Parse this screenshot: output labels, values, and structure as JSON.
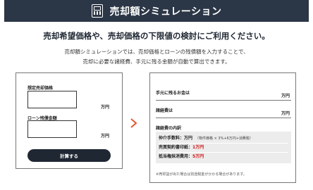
{
  "header": {
    "title": "売却額シミュレーション",
    "icon": "calculator-icon"
  },
  "lead": "売却希望価格や、売却価格の下限値の検討にご利用ください。",
  "desc": {
    "line1": "売却額シミュレーションでは、売却価格とローンの残債額を入力することで、",
    "line2": "売却に必要な諸経費、手元に残る金額が自動で算出できます。"
  },
  "form": {
    "price_label": "想定売却価格",
    "price_value": "",
    "price_unit": "万円",
    "loan_label": "ローン残債金額",
    "loan_value": "",
    "loan_unit": "万円",
    "calc_button": "計算する"
  },
  "result": {
    "remaining_label": "手元に残るお金は",
    "remaining_unit": "万円",
    "expenses_label": "諸経費は",
    "expenses_unit": "万円",
    "breakdown_title": "諸経費の内訳",
    "breakdown": [
      {
        "label": "仲介手数料：",
        "value": "万円",
        "note": "（物件価格 × 3%+6万円+消費税）"
      },
      {
        "label": "売買契約書印紙：",
        "value": "1万円",
        "note": ""
      },
      {
        "label": "抵当権抹消費用：",
        "value": "5万円",
        "note": ""
      }
    ],
    "footnote": "※売却益が出た場合は別途税金がかかる場合があります。"
  },
  "colors": {
    "header_bg": "#2b3646",
    "button_bg": "#1f2733",
    "arrow": "#e4572e",
    "accent_red": "#d21414",
    "breakdown_bg": "#ececec"
  }
}
